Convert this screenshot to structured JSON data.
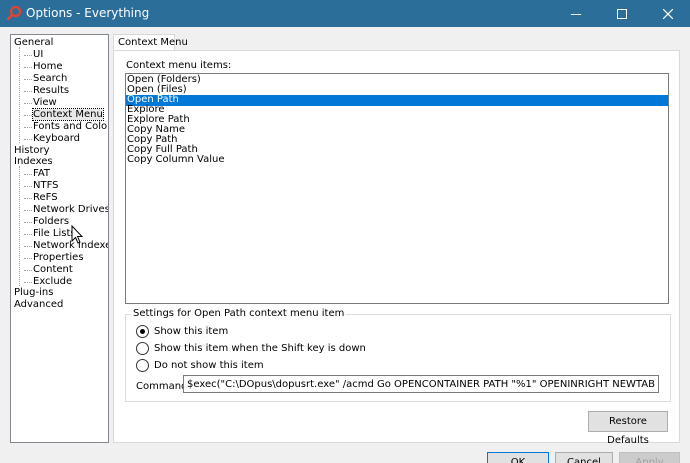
{
  "window": {
    "title": "Options - Everything",
    "app_icon": "search-magnifier-icon",
    "controls": [
      "minimize-icon",
      "maximize-icon",
      "close-icon"
    ]
  },
  "tree": {
    "items": [
      {
        "label": "General",
        "level": 1
      },
      {
        "label": "UI",
        "level": 2
      },
      {
        "label": "Home",
        "level": 2
      },
      {
        "label": "Search",
        "level": 2
      },
      {
        "label": "Results",
        "level": 2
      },
      {
        "label": "View",
        "level": 2
      },
      {
        "label": "Context Menu",
        "level": 2,
        "selected": true
      },
      {
        "label": "Fonts and Colors",
        "level": 2
      },
      {
        "label": "Keyboard",
        "level": 2
      },
      {
        "label": "History",
        "level": 1
      },
      {
        "label": "Indexes",
        "level": 1
      },
      {
        "label": "FAT",
        "level": 2
      },
      {
        "label": "NTFS",
        "level": 2
      },
      {
        "label": "ReFS",
        "level": 2
      },
      {
        "label": "Network Drives",
        "level": 2
      },
      {
        "label": "Folders",
        "level": 2
      },
      {
        "label": "File Lists",
        "level": 2
      },
      {
        "label": "Network Indexes",
        "level": 2
      },
      {
        "label": "Properties",
        "level": 2
      },
      {
        "label": "Content",
        "level": 2
      },
      {
        "label": "Exclude",
        "level": 2
      },
      {
        "label": "Plug-ins",
        "level": 1
      },
      {
        "label": "Advanced",
        "level": 1
      }
    ]
  },
  "tab": {
    "label": "Context Menu"
  },
  "context_menu": {
    "items_label": "Context menu items:",
    "items": [
      "Open (Folders)",
      "Open (Files)",
      "Open Path",
      "Explore",
      "Explore Path",
      "Copy Name",
      "Copy Path",
      "Copy Full Path",
      "Copy Column Value"
    ],
    "selected_item": "Open Path"
  },
  "settings": {
    "group_title": "Settings for Open Path context menu item",
    "options": [
      {
        "label": "Show this item",
        "checked": true
      },
      {
        "label": "Show this item when the Shift key is down",
        "checked": false
      },
      {
        "label": "Do not show this item",
        "checked": false
      }
    ],
    "command_label": "Command:",
    "command_value": "$exec(\"C:\\DOpus\\dopusrt.exe\" /acmd Go OPENCONTAINER PATH \"%1\" OPENINRIGHT NEWTAB=whenexisting)"
  },
  "buttons": {
    "restore_defaults": "Restore Defaults",
    "ok": "OK",
    "cancel": "Cancel",
    "apply": "Apply"
  },
  "colors": {
    "titlebar": "#2b6e99",
    "selection": "#0078d7"
  }
}
